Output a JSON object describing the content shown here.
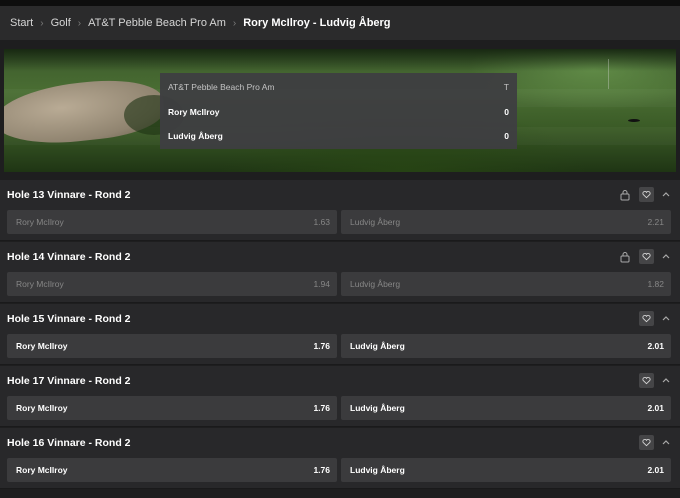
{
  "breadcrumb": [
    "Start",
    "Golf",
    "AT&T Pebble Beach Pro Am",
    "Rory McIlroy - Ludvig Åberg"
  ],
  "scoreboard": {
    "event": "AT&T Pebble Beach Pro Am",
    "event_value": "T",
    "players": [
      {
        "name": "Rory McIlroy",
        "score": "0"
      },
      {
        "name": "Ludvig Åberg",
        "score": "0"
      }
    ]
  },
  "markets": [
    {
      "title": "Hole 13 Vinnare - Rond 2",
      "locked": true,
      "options": [
        {
          "name": "Rory McIlroy",
          "odds": "1.63"
        },
        {
          "name": "Ludvig Åberg",
          "odds": "2.21"
        }
      ]
    },
    {
      "title": "Hole 14 Vinnare - Rond 2",
      "locked": true,
      "options": [
        {
          "name": "Rory McIlroy",
          "odds": "1.94"
        },
        {
          "name": "Ludvig Åberg",
          "odds": "1.82"
        }
      ]
    },
    {
      "title": "Hole 15 Vinnare - Rond 2",
      "locked": false,
      "options": [
        {
          "name": "Rory McIlroy",
          "odds": "1.76"
        },
        {
          "name": "Ludvig Åberg",
          "odds": "2.01"
        }
      ]
    },
    {
      "title": "Hole 17 Vinnare - Rond 2",
      "locked": false,
      "options": [
        {
          "name": "Rory McIlroy",
          "odds": "1.76"
        },
        {
          "name": "Ludvig Åberg",
          "odds": "2.01"
        }
      ]
    },
    {
      "title": "Hole 16 Vinnare - Rond 2",
      "locked": false,
      "options": [
        {
          "name": "Rory McIlroy",
          "odds": "1.76"
        },
        {
          "name": "Ludvig Åberg",
          "odds": "2.01"
        }
      ]
    }
  ],
  "icons": {
    "lock": "lock-icon",
    "favorite": "heart-icon",
    "collapse": "chevron-up-icon"
  }
}
